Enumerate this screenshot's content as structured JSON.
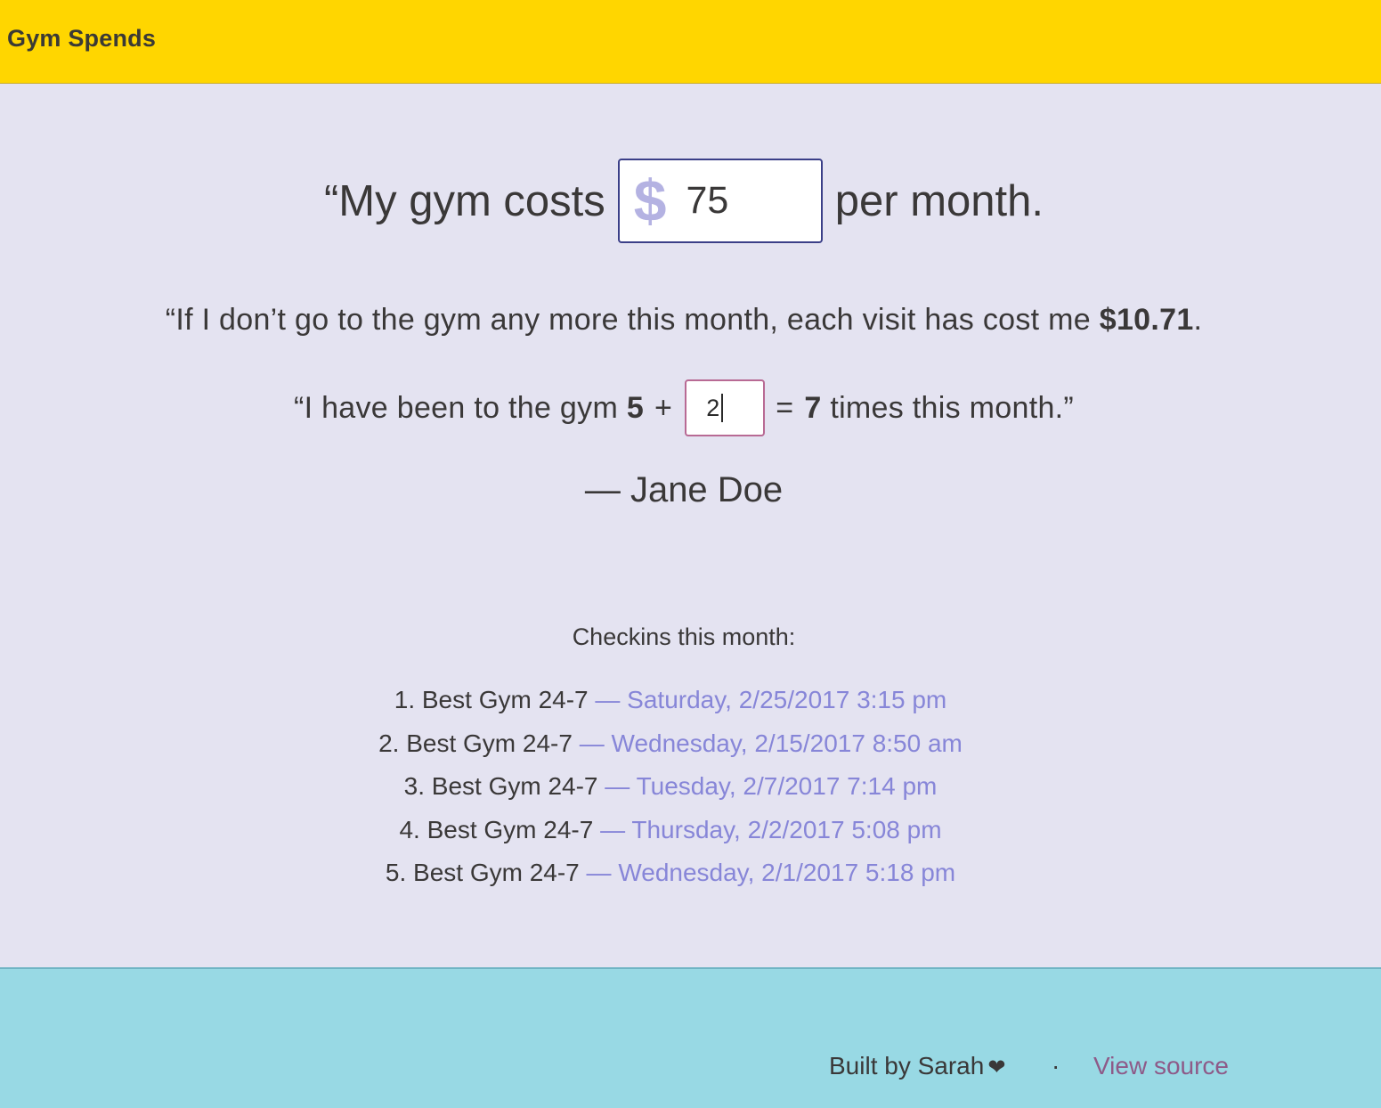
{
  "header": {
    "brand": "Gym Spends"
  },
  "cost": {
    "prefix": "“My gym costs",
    "currency_icon": "dollar-sign-icon",
    "value": "75",
    "suffix": "per month."
  },
  "summary": {
    "text": "“If I don’t go to the gym any more this month, each visit has cost me ",
    "amount": "$10.71",
    "end": "."
  },
  "visits": {
    "prefix": "“I have been to the gym ",
    "base": "5",
    "plus": "+",
    "extra_value": "2",
    "equals": "=",
    "total": "7",
    "suffix": " times this month.”"
  },
  "signature": "— Jane Doe",
  "checkins": {
    "title": "Checkins this month:",
    "items": [
      {
        "gym": "1. Best Gym 24-7",
        "when": " — Saturday, 2/25/2017 3:15 pm"
      },
      {
        "gym": "2. Best Gym 24-7",
        "when": " — Wednesday, 2/15/2017 8:50 am"
      },
      {
        "gym": "3. Best Gym 24-7",
        "when": " — Tuesday, 2/7/2017 7:14 pm"
      },
      {
        "gym": "4. Best Gym 24-7",
        "when": " — Thursday, 2/2/2017 5:08 pm"
      },
      {
        "gym": "5. Best Gym 24-7",
        "when": " — Wednesday, 2/1/2017 5:18 pm"
      }
    ]
  },
  "footer": {
    "built_by": "Built by Sarah",
    "heart_icon": "heart-icon",
    "separator": "·",
    "source_link": "View source"
  },
  "colors": {
    "header_bg": "#ffd600",
    "main_bg": "#e4e3f1",
    "footer_bg": "#98d9e4",
    "link": "#8786d8",
    "source_link": "#8e5a88"
  }
}
